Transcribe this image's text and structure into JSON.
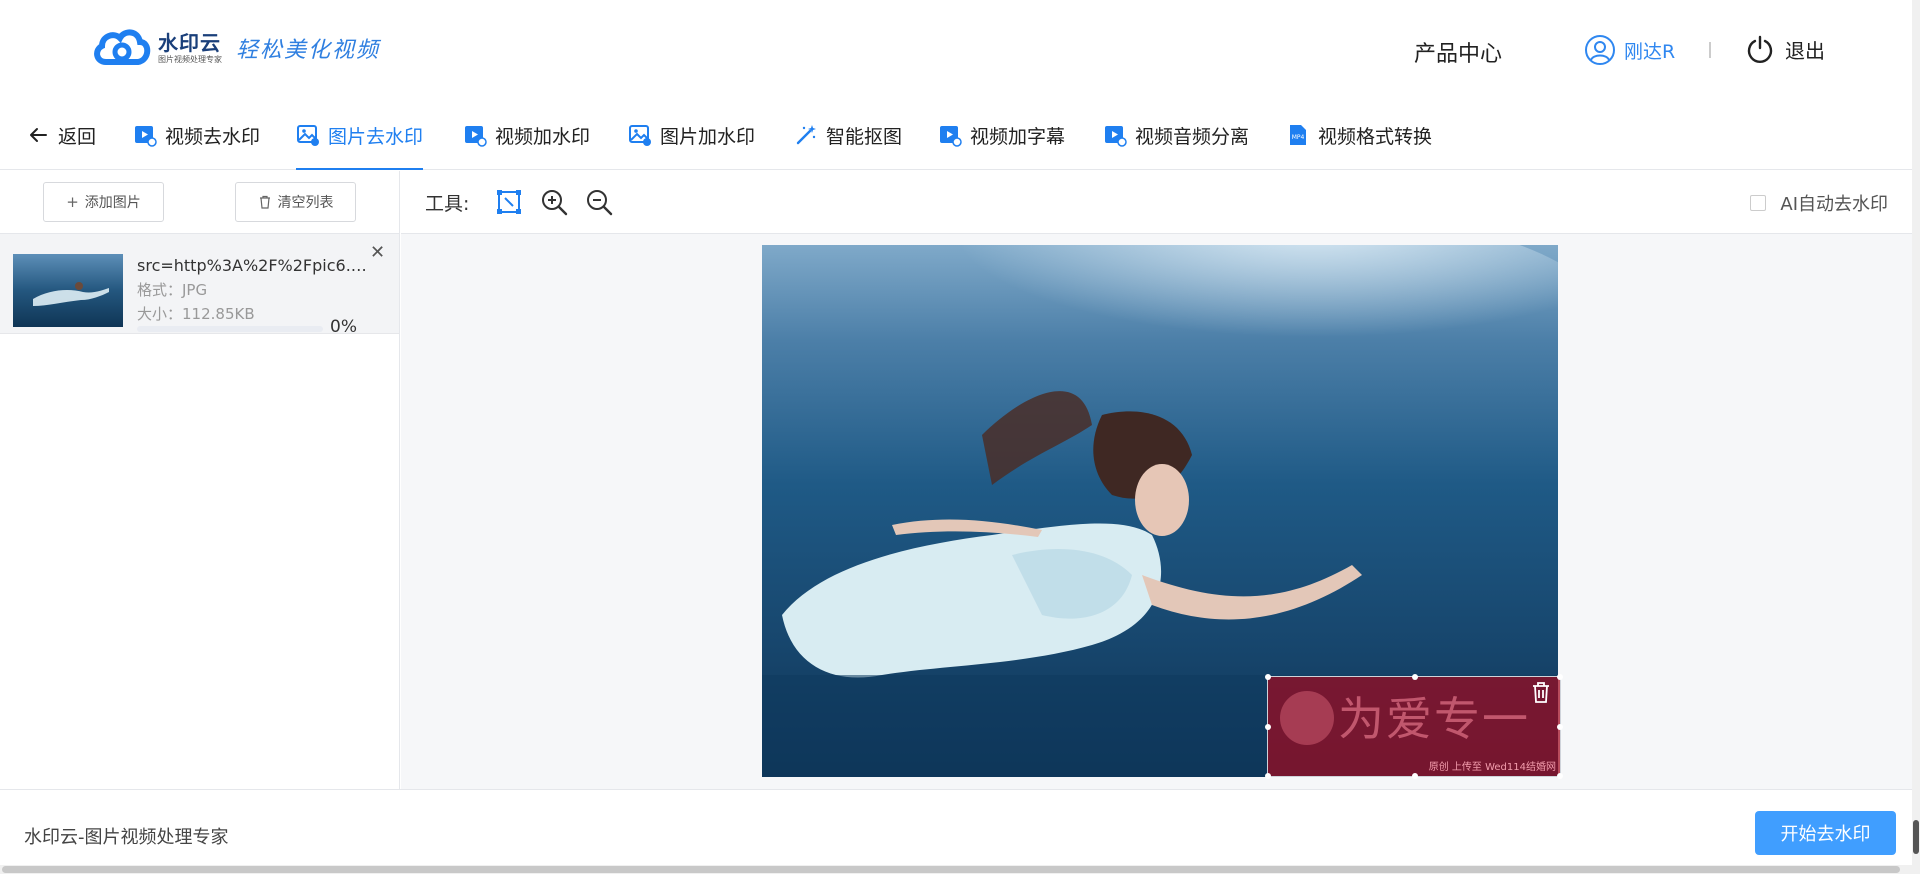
{
  "header": {
    "logo_name": "水印云",
    "logo_sub": "图片视频处理专家",
    "slogan": "轻松美化视频",
    "product_center": "产品中心",
    "username": "刚达R",
    "logout": "退出"
  },
  "nav": {
    "back": "返回",
    "items": [
      {
        "label": "视频去水印",
        "icon": "video-icon"
      },
      {
        "label": "图片去水印",
        "icon": "image-icon",
        "active": true
      },
      {
        "label": "视频加水印",
        "icon": "video-icon"
      },
      {
        "label": "图片加水印",
        "icon": "image-icon"
      },
      {
        "label": "智能抠图",
        "icon": "magic-wand-icon"
      },
      {
        "label": "视频加字幕",
        "icon": "video-icon"
      },
      {
        "label": "视频音频分离",
        "icon": "video-icon"
      },
      {
        "label": "视频格式转换",
        "icon": "mp4-file-icon"
      }
    ]
  },
  "left": {
    "add_image": "添加图片",
    "clear_list": "清空列表",
    "file": {
      "name": "src=http%3A%2F%2Fpic6.we...",
      "format_label": "格式：JPG",
      "size_label": "大小：112.85KB",
      "progress_text": "0%",
      "progress": 0
    }
  },
  "workspace": {
    "tools_label": "工具:",
    "ai_auto": "AI自动去水印",
    "ai_auto_checked": false,
    "watermark_text": "为爱专一",
    "watermark_small": "原创 上传至 Wed114结婚网"
  },
  "footer": {
    "brand": "水印云-图片视频处理专家",
    "start_button": "开始去水印"
  },
  "colors": {
    "accent": "#1f7ff0",
    "button": "#409eff"
  }
}
